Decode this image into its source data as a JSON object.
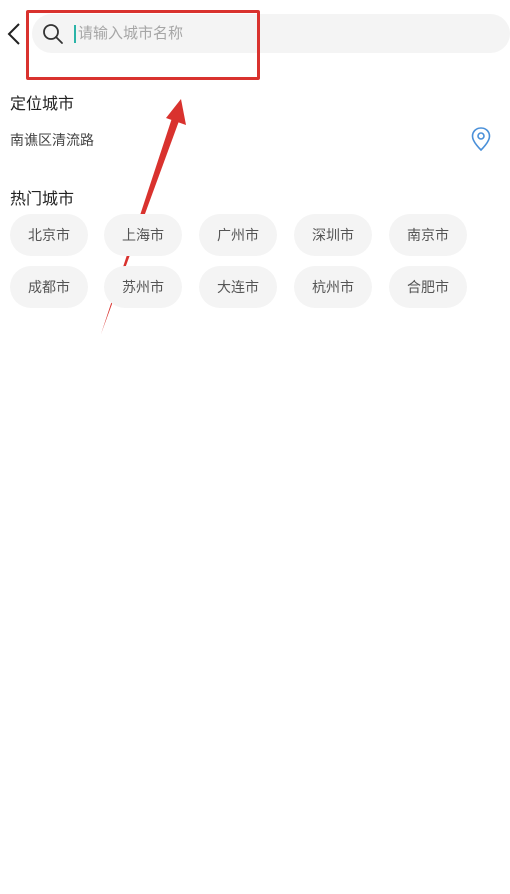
{
  "search": {
    "placeholder": "请输入城市名称",
    "value": ""
  },
  "location_section": {
    "title": "定位城市",
    "current": "南谯区清流路"
  },
  "hot_section": {
    "title": "热门城市",
    "cities": [
      "北京市",
      "上海市",
      "广州市",
      "深圳市",
      "南京市",
      "成都市",
      "苏州市",
      "大连市",
      "杭州市",
      "合肥市"
    ]
  },
  "colors": {
    "annotation": "#d9322e",
    "cursor": "#2bb4a8",
    "chip_bg": "#f4f4f4",
    "locate_icon": "#4a90d9"
  },
  "icons": {
    "back": "chevron-left-icon",
    "search": "search-icon",
    "locate": "location-pin-icon"
  }
}
